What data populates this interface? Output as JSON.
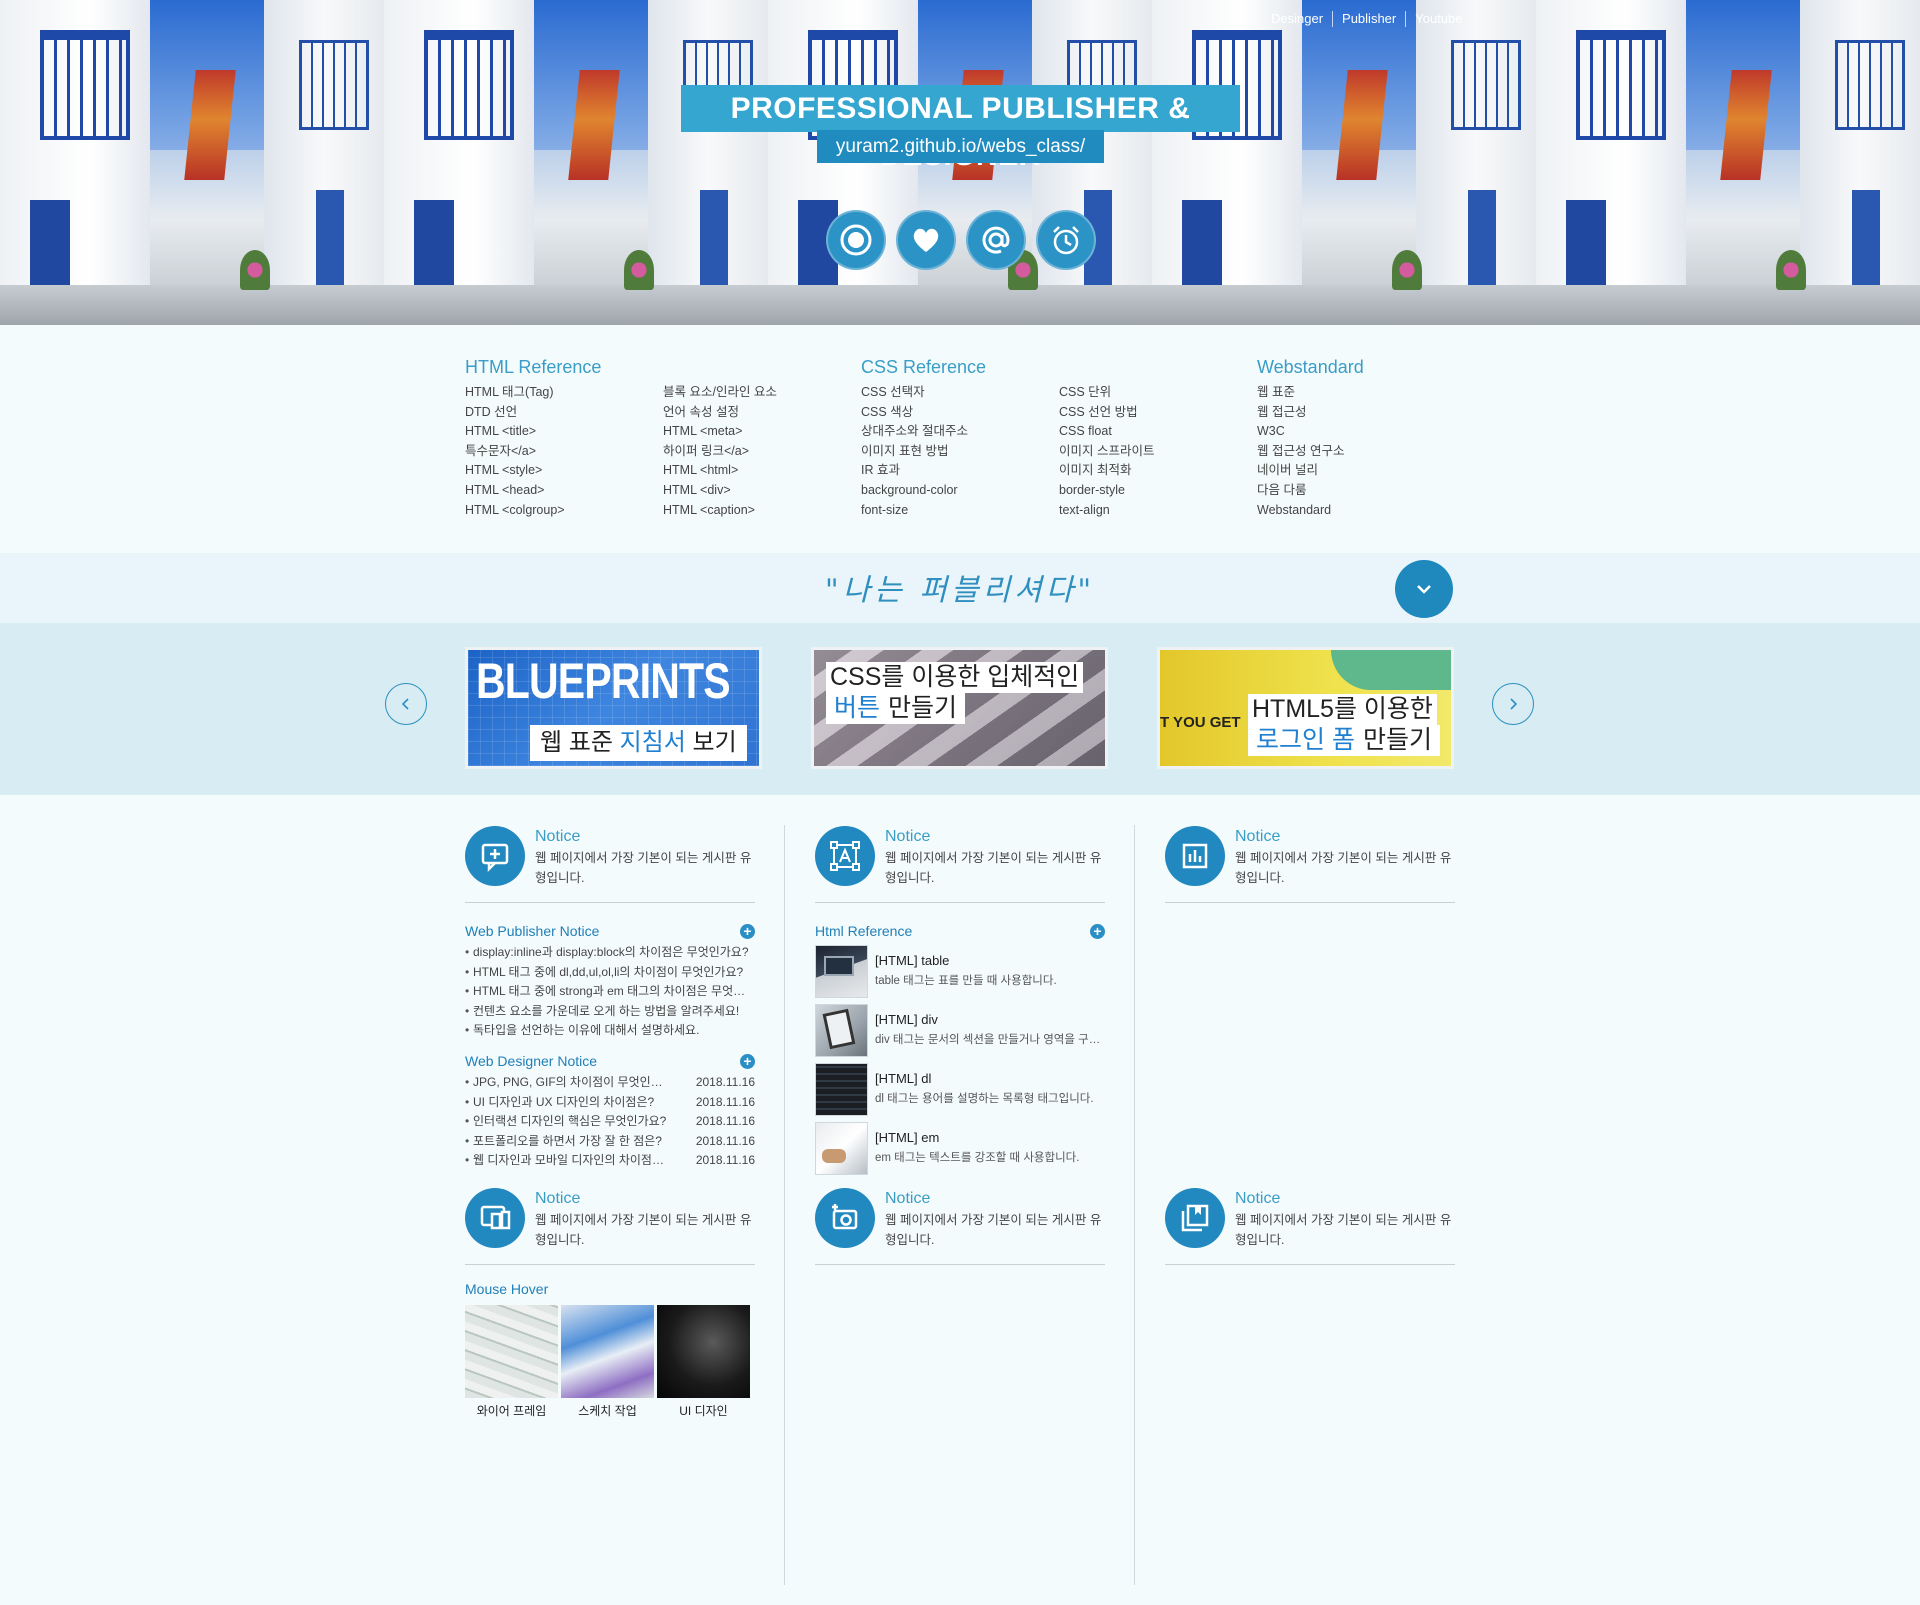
{
  "header": {
    "nav": [
      "Desinger",
      "Publisher",
      "Youtube"
    ],
    "title": "PROFESSIONAL PUBLISHER & DESIGNER",
    "url": "yuram2.github.io/webs_class/",
    "icons": [
      "target-icon",
      "heart-icon",
      "at-sign-icon",
      "alarm-clock-icon"
    ]
  },
  "reference": [
    {
      "title": "HTML Reference",
      "items": [
        "HTML 태그(Tag)",
        "블록 요소/인라인 요소",
        "DTD 선언",
        "언어 속성 설정",
        "HTML <title>",
        "HTML <meta>",
        "특수문자</a>",
        "하이퍼 링크</a>",
        "HTML <style>",
        "HTML <html>",
        "HTML <head>",
        "HTML <div>",
        "HTML <colgroup>",
        "HTML <caption>"
      ]
    },
    {
      "title": "CSS Reference",
      "items": [
        "CSS 선택자",
        "CSS 단위",
        "CSS 색상",
        "CSS 선언 방법",
        "상대주소와 절대주소",
        "CSS float",
        "이미지 표현 방법",
        "이미지 스프라이트",
        "IR 효과",
        "이미지 최적화",
        "background-color",
        "border-style",
        "font-size",
        "text-align"
      ]
    },
    {
      "title": "Webstandard",
      "items": [
        "웹 표준",
        "웹 접근성",
        "W3C",
        "웹 접근성 연구소",
        "네이버 널리",
        "다음 다룸",
        "Webstandard"
      ]
    }
  ],
  "slogan": "\"나는 퍼블리셔다\"",
  "banners": [
    {
      "big": "BLUEPRINTS",
      "line1_a": "웹 표준 ",
      "line1_hl": "지침서",
      "line1_b": " 보기"
    },
    {
      "line1": "CSS를 이용한 입체적인",
      "line2_hl": "버튼",
      "line2_b": " 만들기"
    },
    {
      "tag": "T YOU GET",
      "line1": "HTML5를 이용한",
      "line2_hl": "로그인 폼",
      "line2_b": " 만들기"
    }
  ],
  "notice": {
    "title": "Notice",
    "desc": "웹 페이지에서 가장 기본이 되는 게시판 유형입니다."
  },
  "publisher_notice": {
    "title": "Web Publisher Notice",
    "items": [
      "display:inline과 display:block의 차이점은 무엇인가요?",
      "HTML 태그 중에 dl,dd,ul,ol,li의 차이점이 무엇인가요?",
      "HTML 태그 중에 strong과 em 태그의 차이점은 무엇인가요?",
      "컨텐츠 요소를 가운데로 오게 하는 방법을 알려주세요!",
      "독타입을 선언하는 이유에 대해서 설명하세요."
    ]
  },
  "designer_notice": {
    "title": "Web Designer Notice",
    "items": [
      {
        "text": "JPG, PNG, GIF의 차이점이 무엇인가요?",
        "date": "2018.11.16"
      },
      {
        "text": "UI 디자인과 UX 디자인의 차이점은?",
        "date": "2018.11.16"
      },
      {
        "text": "인터랙션 디자인의 핵심은 무엇인가요?",
        "date": "2018.11.16"
      },
      {
        "text": "포트폴리오를 하면서 가장 잘 한 점은?",
        "date": "2018.11.16"
      },
      {
        "text": "웹 디자인과 모바일 디자인의 차이점은?",
        "date": "2018.11.16"
      }
    ]
  },
  "html_reference": {
    "title": "Html Reference",
    "items": [
      {
        "title": "[HTML] table",
        "desc": "table 태그는 표를 만들 때 사용합니다."
      },
      {
        "title": "[HTML] div",
        "desc": "div 태그는 문서의 섹션을 만들거나 영역을 구분할 때 사용합니다."
      },
      {
        "title": "[HTML] dl",
        "desc": "dl 태그는 용어를 설명하는 목록형 태그입니다."
      },
      {
        "title": "[HTML] em",
        "desc": "em 태그는 텍스트를 강조할 때 사용합니다."
      }
    ]
  },
  "mouse_hover": {
    "title": "Mouse Hover",
    "items": [
      "와이어 프레임",
      "스케치 작업",
      "UI 디자인"
    ]
  },
  "colors": {
    "accent": "#2189bf",
    "title_bg": "#34a6d0",
    "url_bg": "#1f8bbf"
  }
}
